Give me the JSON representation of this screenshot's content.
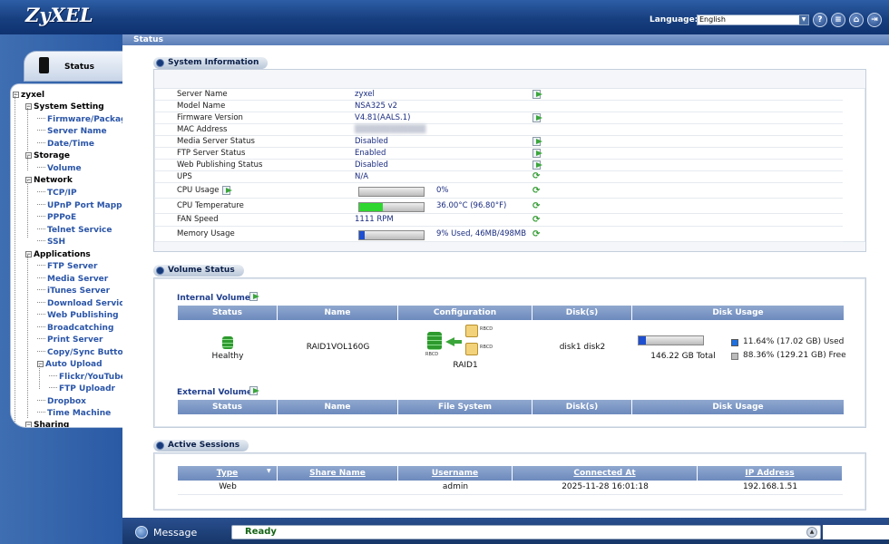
{
  "header": {
    "logo": "ZyXEL",
    "language_label": "Language:",
    "language_value": "English",
    "icons": [
      "help-icon",
      "list-icon",
      "home-icon",
      "logout-icon"
    ]
  },
  "left": {
    "tab_label": "Status",
    "tree": [
      {
        "label": "zyxel",
        "level": "root"
      },
      {
        "label": "System Setting",
        "level": "lvl1"
      },
      {
        "label": "Firmware/Package",
        "level": "lvl2"
      },
      {
        "label": "Server Name",
        "level": "lvl2"
      },
      {
        "label": "Date/Time",
        "level": "lvl2"
      },
      {
        "label": "Storage",
        "level": "lvl1"
      },
      {
        "label": "Volume",
        "level": "lvl2"
      },
      {
        "label": "Network",
        "level": "lvl1"
      },
      {
        "label": "TCP/IP",
        "level": "lvl2"
      },
      {
        "label": "UPnP Port Mapping",
        "level": "lvl2"
      },
      {
        "label": "PPPoE",
        "level": "lvl2"
      },
      {
        "label": "Telnet Service",
        "level": "lvl2"
      },
      {
        "label": "SSH",
        "level": "lvl2"
      },
      {
        "label": "Applications",
        "level": "lvl1"
      },
      {
        "label": "FTP Server",
        "level": "lvl2"
      },
      {
        "label": "Media Server",
        "level": "lvl2"
      },
      {
        "label": "iTunes Server",
        "level": "lvl2"
      },
      {
        "label": "Download Service",
        "level": "lvl2"
      },
      {
        "label": "Web Publishing",
        "level": "lvl2"
      },
      {
        "label": "Broadcatching",
        "level": "lvl2"
      },
      {
        "label": "Print Server",
        "level": "lvl2"
      },
      {
        "label": "Copy/Sync Button",
        "level": "lvl2"
      },
      {
        "label": "Auto Upload",
        "level": "lvl2"
      },
      {
        "label": "Flickr/YouTube",
        "level": "lvl3"
      },
      {
        "label": "FTP Uploadr",
        "level": "lvl3"
      },
      {
        "label": "Dropbox",
        "level": "lvl2"
      },
      {
        "label": "Time Machine",
        "level": "lvl2"
      },
      {
        "label": "Sharing",
        "level": "lvl1"
      }
    ]
  },
  "breadcrumb": "Status",
  "system_info": {
    "title": "System Information",
    "rows": [
      {
        "key": "Server Name",
        "value": "zyxel",
        "action": "go"
      },
      {
        "key": "Model Name",
        "value": "NSA325 v2",
        "action": ""
      },
      {
        "key": "Firmware Version",
        "value": "V4.81(AALS.1)",
        "action": "go"
      },
      {
        "key": "MAC Address",
        "value": "",
        "action": ""
      },
      {
        "key": "Media Server Status",
        "value": "Disabled",
        "action": "go"
      },
      {
        "key": "FTP Server Status",
        "value": "Enabled",
        "action": "go"
      },
      {
        "key": "Web Publishing Status",
        "value": "Disabled",
        "action": "go"
      },
      {
        "key": "UPS",
        "value": "N/A",
        "action": "refresh"
      }
    ],
    "cpu_usage_label": "CPU Usage",
    "cpu_usage_value": "0%",
    "cpu_usage_fraction": 0.0,
    "cpu_temp_label": "CPU Temperature",
    "cpu_temp_value": "36.00°C (96.80°F)",
    "cpu_temp_fraction": 0.36,
    "fan_label": "FAN Speed",
    "fan_value": "1111 RPM",
    "memory_label": "Memory Usage",
    "memory_value": "9% Used, 46MB/498MB",
    "memory_fraction": 0.09,
    "bar_colors": {
      "temp": "#2fd62f",
      "memory": "#1e4fd0"
    }
  },
  "volume_status": {
    "title": "Volume Status",
    "internal_label": "Internal Volume",
    "external_label": "External Volume",
    "columns": [
      "Status",
      "Name",
      "Configuration",
      "Disk(s)",
      "Disk Usage"
    ],
    "external_columns": [
      "Status",
      "Name",
      "File System",
      "Disk(s)",
      "Disk Usage"
    ],
    "row": {
      "status": "Healthy",
      "name": "RAID1VOL160G",
      "config_tag": "RAID1",
      "disk_labels": [
        "RBCD",
        "RBCD",
        "RBCD"
      ],
      "disks": "disk1 disk2",
      "total": "146.22 GB Total",
      "used_fraction": 0.1164,
      "used": "11.64% (17.02 GB) Used",
      "free": "88.36% (129.21 GB) Free"
    }
  },
  "active_sessions": {
    "title": "Active Sessions",
    "columns": [
      "Type",
      "Share Name",
      "Username",
      "Connected At",
      "IP Address"
    ],
    "rows": [
      {
        "type": "Web",
        "share": "",
        "user": "admin",
        "time": "2025-11-28 16:01:18",
        "ip": "192.168.1.51"
      }
    ]
  },
  "message": {
    "label": "Message",
    "text": "Ready"
  }
}
